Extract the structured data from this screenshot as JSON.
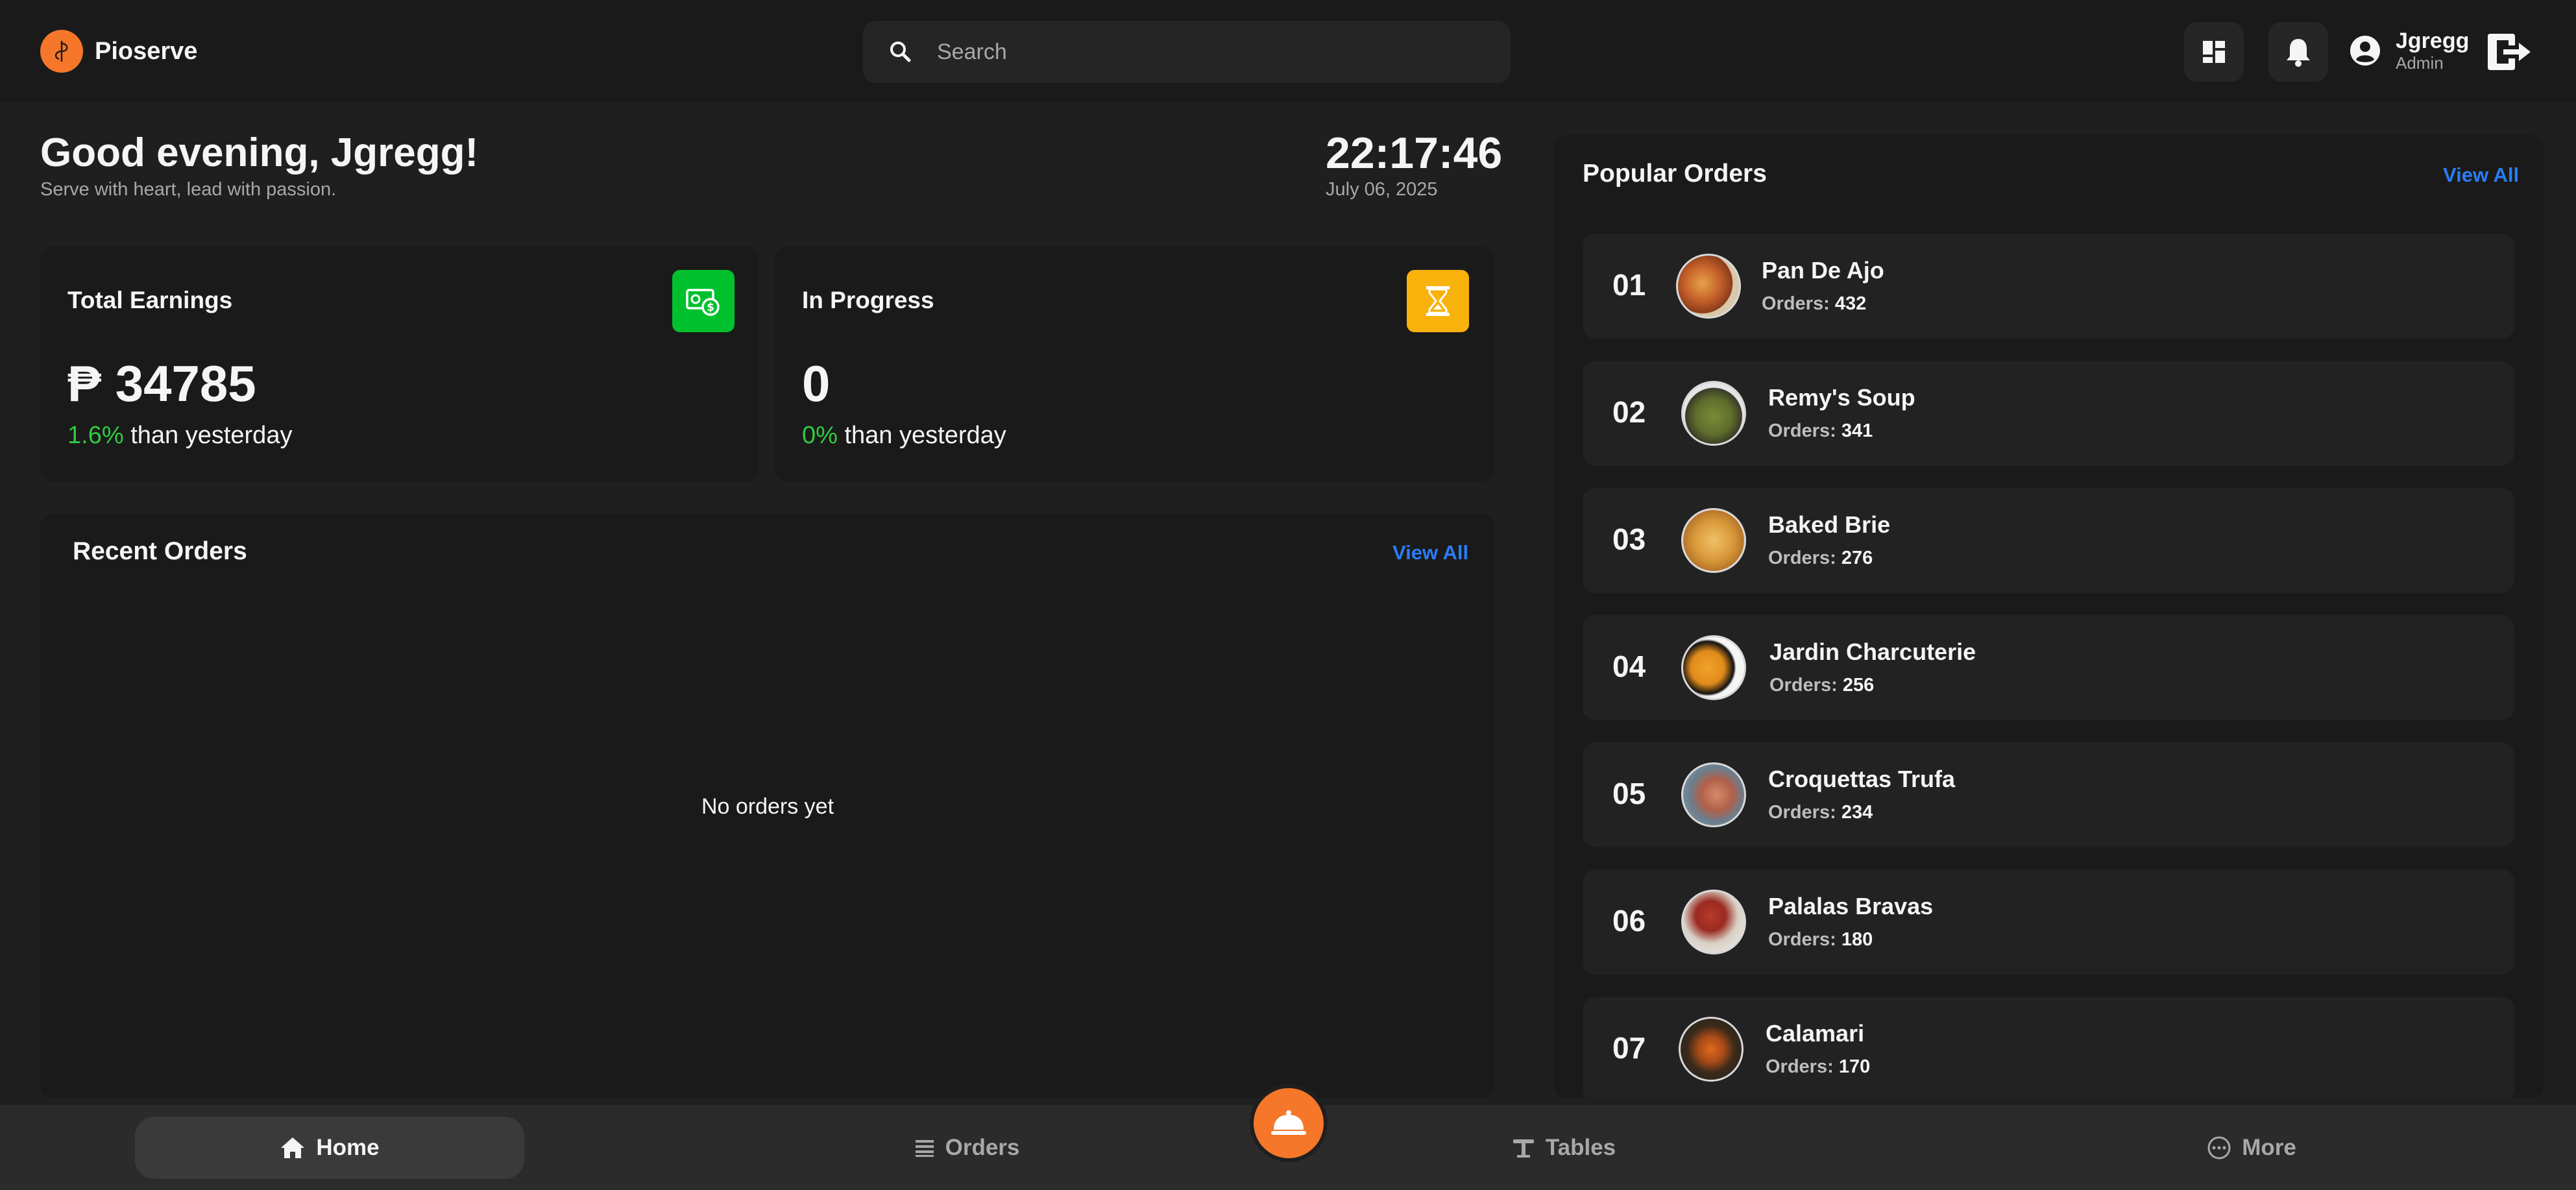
{
  "app": {
    "name": "Pioserve"
  },
  "search": {
    "placeholder": "Search"
  },
  "user": {
    "name": "Jgregg",
    "role": "Admin"
  },
  "greeting": {
    "title": "Good evening, Jgregg!",
    "subtitle": "Serve with heart, lead with passion."
  },
  "clock": {
    "time": "22:17:46",
    "date": "July 06, 2025"
  },
  "stats": {
    "earnings": {
      "title": "Total Earnings",
      "value": "₱ 34785",
      "delta_pct": "1.6%",
      "delta_text": "than yesterday",
      "icon": "money-icon",
      "color": "#00c02e"
    },
    "progress": {
      "title": "In Progress",
      "value": "0",
      "delta_pct": "0%",
      "delta_text": "than yesterday",
      "icon": "hourglass-icon",
      "color": "#f9b10c"
    }
  },
  "recent_orders": {
    "title": "Recent Orders",
    "view_all": "View All",
    "empty_text": "No orders yet"
  },
  "popular_orders": {
    "title": "Popular Orders",
    "view_all": "View All",
    "count_label": "Orders:",
    "items": [
      {
        "rank": "01",
        "name": "Pan De Ajo",
        "orders": "432"
      },
      {
        "rank": "02",
        "name": "Remy's Soup",
        "orders": "341"
      },
      {
        "rank": "03",
        "name": "Baked Brie",
        "orders": "276"
      },
      {
        "rank": "04",
        "name": "Jardin Charcuterie",
        "orders": "256"
      },
      {
        "rank": "05",
        "name": "Croquettas Trufa",
        "orders": "234"
      },
      {
        "rank": "06",
        "name": "Palalas Bravas",
        "orders": "180"
      },
      {
        "rank": "07",
        "name": "Calamari",
        "orders": "170"
      }
    ]
  },
  "nav": {
    "home": "Home",
    "orders": "Orders",
    "tables": "Tables",
    "more": "More"
  },
  "colors": {
    "accent": "#f6762a",
    "link": "#2a7df4",
    "positive": "#2ecc40"
  }
}
